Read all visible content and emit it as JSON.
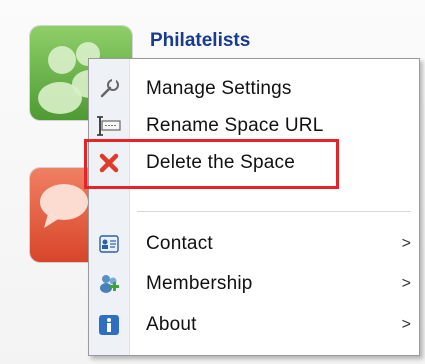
{
  "space": {
    "title": "Philatelists"
  },
  "menu": {
    "items": [
      {
        "label": "Manage Settings",
        "icon": "wrench-icon"
      },
      {
        "label": "Rename Space URL",
        "icon": "rename-url-icon"
      },
      {
        "label": "Delete the Space",
        "icon": "delete-x-icon"
      },
      {
        "label": "Contact",
        "icon": "contact-card-icon",
        "submenu_arrow": ">"
      },
      {
        "label": "Membership",
        "icon": "membership-icon",
        "submenu_arrow": ">"
      },
      {
        "label": "About",
        "icon": "info-icon",
        "submenu_arrow": ">"
      }
    ]
  },
  "colors": {
    "title": "#173b91",
    "highlight": "#e5242a",
    "green_tile": "#4e9a33",
    "red_tile": "#d8452a"
  }
}
